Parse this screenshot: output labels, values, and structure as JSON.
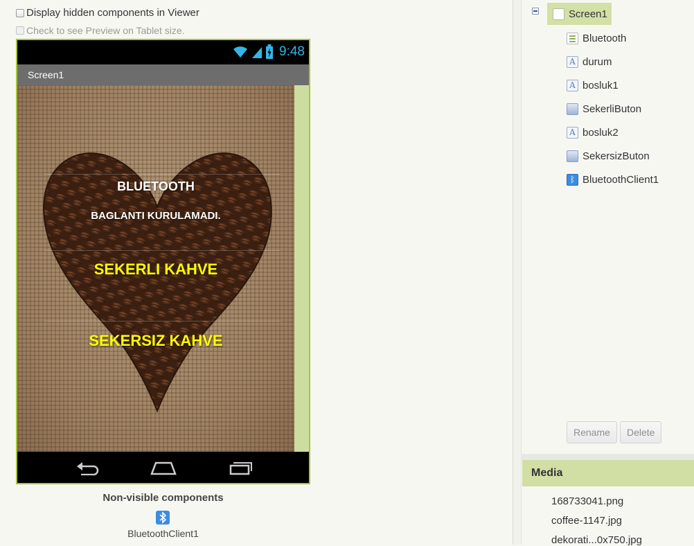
{
  "viewer": {
    "option_hidden_label": "Display hidden components in Viewer",
    "option_tablet_label": "Check to see Preview on Tablet size."
  },
  "phone": {
    "status_time": "9:48",
    "screen_title": "Screen1",
    "texts": {
      "bluetooth_heading": "BLUETOOTH",
      "status_text": "BAGLANTI KURULAMADI.",
      "sekerli_button": "SEKERLI KAHVE",
      "sekersiz_button": "SEKERSIZ KAHVE"
    }
  },
  "non_visible": {
    "title": "Non-visible components",
    "items": [
      {
        "label": "BluetoothClient1",
        "icon": "bluetooth-icon"
      }
    ]
  },
  "components": {
    "root": {
      "label": "Screen1",
      "icon": "screen-icon"
    },
    "items": [
      {
        "label": "Bluetooth",
        "icon": "list-icon"
      },
      {
        "label": "durum",
        "icon": "label-icon"
      },
      {
        "label": "bosluk1",
        "icon": "label-icon"
      },
      {
        "label": "SekerliButon",
        "icon": "button-icon"
      },
      {
        "label": "bosluk2",
        "icon": "label-icon"
      },
      {
        "label": "SekersizButon",
        "icon": "button-icon"
      },
      {
        "label": "BluetoothClient1",
        "icon": "bluetooth-icon"
      }
    ],
    "rename_label": "Rename",
    "delete_label": "Delete"
  },
  "media": {
    "title": "Media",
    "items": [
      "168733041.png",
      "coffee-1147.jpg",
      "dekorati...0x750.jpg"
    ]
  },
  "colors": {
    "selection_green": "#d3e0a6",
    "phone_border": "#a5c63b",
    "status_blue": "#33b5e5",
    "button_text_yellow": "#ffff00"
  }
}
